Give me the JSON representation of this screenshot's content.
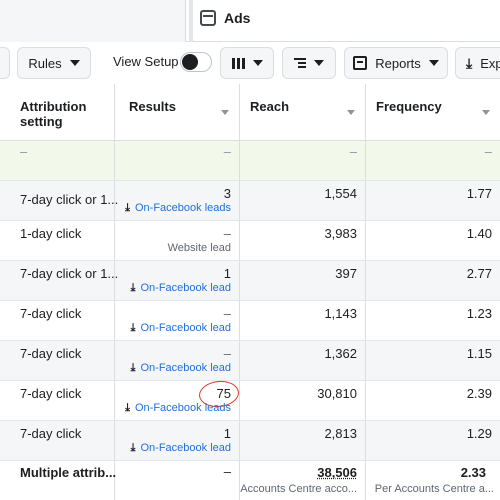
{
  "tab": {
    "title": "Ads"
  },
  "toolbar": {
    "rules_label": "Rules",
    "view_setup_label": "View Setup",
    "reports_label": "Reports",
    "export_label": "Exp"
  },
  "table": {
    "headers": {
      "attribution": "Attribution setting",
      "results": "Results",
      "reach": "Reach",
      "frequency": "Frequency"
    },
    "placeholder_row": {
      "attribution": "–",
      "results": "–",
      "reach": "–",
      "frequency": "–"
    },
    "rows": [
      {
        "attribution": "7-day click or 1...",
        "results": "3",
        "result_type": "On-Facebook leads",
        "reach": "1,554",
        "frequency": "1.77"
      },
      {
        "attribution": "1-day click",
        "results": "–",
        "result_type": "Website lead",
        "reach": "3,983",
        "frequency": "1.40"
      },
      {
        "attribution": "7-day click or 1...",
        "results": "1",
        "result_type": "On-Facebook lead",
        "reach": "397",
        "frequency": "2.77"
      },
      {
        "attribution": "7-day click",
        "results": "–",
        "result_type": "On-Facebook lead",
        "reach": "1,143",
        "frequency": "1.23"
      },
      {
        "attribution": "7-day click",
        "results": "–",
        "result_type": "On-Facebook lead",
        "reach": "1,362",
        "frequency": "1.15"
      },
      {
        "attribution": "7-day click",
        "results": "75",
        "result_type": "On-Facebook leads",
        "reach": "30,810",
        "frequency": "2.39"
      },
      {
        "attribution": "7-day click",
        "results": "1",
        "result_type": "On-Facebook lead",
        "reach": "2,813",
        "frequency": "1.29"
      }
    ],
    "summary": {
      "attribution": "Multiple attrib...",
      "results": "–",
      "reach": "38,506",
      "reach_sub": "Accounts Centre acco...",
      "frequency": "2.33",
      "frequency_sub": "Per Accounts Centre a..."
    }
  },
  "colors": {
    "accent_link": "#216fdb",
    "highlight_row": "#f3f9ea",
    "annotation_circle": "#e0352b"
  }
}
